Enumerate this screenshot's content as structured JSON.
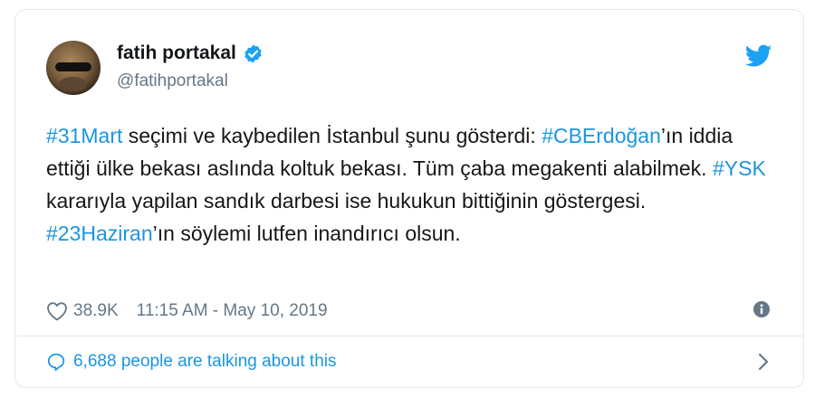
{
  "user": {
    "display_name": "fatih portakal",
    "handle": "@fatihportakal",
    "verified": true
  },
  "tweet": {
    "segments": [
      {
        "text": "#31Mart",
        "hashtag": true
      },
      {
        "text": " seçimi ve kaybedilen İstanbul şunu gösterdi: ",
        "hashtag": false
      },
      {
        "text": "#CBErdoğan",
        "hashtag": true
      },
      {
        "text": "’ın iddia ettiği ülke bekası aslında koltuk bekası. Tüm çaba megakenti alabilmek. ",
        "hashtag": false
      },
      {
        "text": "#YSK",
        "hashtag": true
      },
      {
        "text": " kararıyla yapilan sandık darbesi ise hukukun bittiğinin göstergesi. ",
        "hashtag": false
      },
      {
        "text": "#23Haziran",
        "hashtag": true
      },
      {
        "text": "’ın söylemi lutfen inandırıcı olsun.",
        "hashtag": false
      }
    ]
  },
  "meta": {
    "likes": "38.9K",
    "timestamp": "11:15 AM - May 10, 2019"
  },
  "footer": {
    "talking_label": "6,688 people are talking about this"
  },
  "icons": {
    "heart": "heart-icon",
    "verified": "verified-badge-icon",
    "twitter": "twitter-bird-icon",
    "info": "info-icon",
    "comment": "speech-bubble-icon",
    "chevron": "chevron-right-icon"
  },
  "colors": {
    "link": "#1b95e0",
    "text": "#14171a",
    "muted": "#657786",
    "border": "#e1e8ed"
  }
}
